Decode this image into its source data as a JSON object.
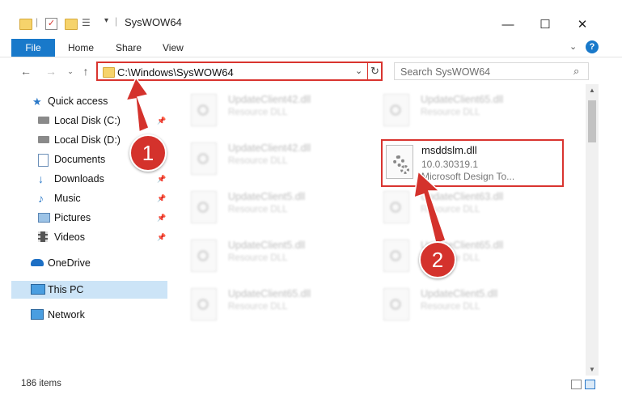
{
  "window": {
    "title": "SysWOW64",
    "controls": {
      "minimize": "—",
      "maximize": "☐",
      "close": "✕"
    }
  },
  "ribbon": {
    "file": "File",
    "home": "Home",
    "share": "Share",
    "view": "View",
    "help": "?"
  },
  "address": {
    "path": "C:\\Windows\\SysWOW64",
    "search_placeholder": "Search SysWOW64"
  },
  "sidebar": {
    "items": [
      {
        "label": "Quick access",
        "icon": "star-icon"
      },
      {
        "label": "Local Disk (C:)",
        "icon": "drive-icon"
      },
      {
        "label": "Local Disk (D:)",
        "icon": "drive-icon"
      },
      {
        "label": "Documents",
        "icon": "documents-icon"
      },
      {
        "label": "Downloads",
        "icon": "download-icon"
      },
      {
        "label": "Music",
        "icon": "music-icon"
      },
      {
        "label": "Pictures",
        "icon": "pictures-icon"
      },
      {
        "label": "Videos",
        "icon": "videos-icon"
      },
      {
        "label": "OneDrive",
        "icon": "cloud-icon"
      },
      {
        "label": "This PC",
        "icon": "computer-icon"
      },
      {
        "label": "Network",
        "icon": "network-icon"
      }
    ]
  },
  "files": [
    {
      "name": "UpdateClient42.dll",
      "type": "Resource DLL"
    },
    {
      "name": "UpdateClient65.dll",
      "type": "Resource DLL"
    },
    {
      "name": "UpdateClient42.dll",
      "type": "Resource DLL"
    },
    {
      "name": "UpdateClient5.dll",
      "type": "Resource DLL"
    },
    {
      "name": "UpdateClient63.dll",
      "type": "Resource DLL"
    },
    {
      "name": "UpdateClient5.dll",
      "type": "Resource DLL"
    },
    {
      "name": "UpdateClient65.dll",
      "type": "Resource DLL"
    },
    {
      "name": "UpdateClient65.dll",
      "type": "Resource DLL"
    },
    {
      "name": "UpdateClient5.dll",
      "type": "Resource DLL"
    }
  ],
  "highlighted_file": {
    "name": "msddslm.dll",
    "version": "10.0.30319.1",
    "description": "Microsoft Design To..."
  },
  "status": {
    "items": "186 items"
  },
  "annotations": {
    "step1": "1",
    "step2": "2"
  },
  "colors": {
    "accent": "#1979ca",
    "highlight": "#d9342f",
    "selection": "#cce4f7"
  }
}
